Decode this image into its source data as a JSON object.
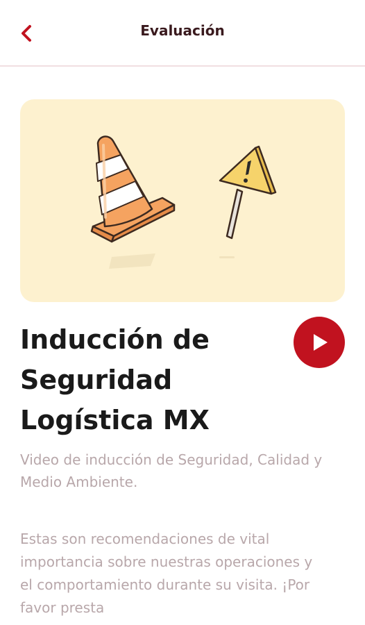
{
  "header": {
    "title": "Evaluación",
    "back_icon": "chevron-left-icon"
  },
  "hero": {
    "illustration": "traffic-cone-and-warning-sign",
    "background_color": "#fdf1cf"
  },
  "content": {
    "title": "Inducción de Seguridad Logística MX",
    "subtitle": "Video de inducción de Seguridad, Calidad y Medio Ambiente.",
    "description": "Estas son recomendaciones de vital importancia sobre nuestras operaciones y el comportamiento durante su visita. ¡Por favor presta"
  },
  "play_button": {
    "icon": "play-icon",
    "color": "#c1121f"
  },
  "colors": {
    "accent": "#c1121f",
    "muted_text": "#b8a7aa",
    "title_text": "#1a1a1a"
  }
}
